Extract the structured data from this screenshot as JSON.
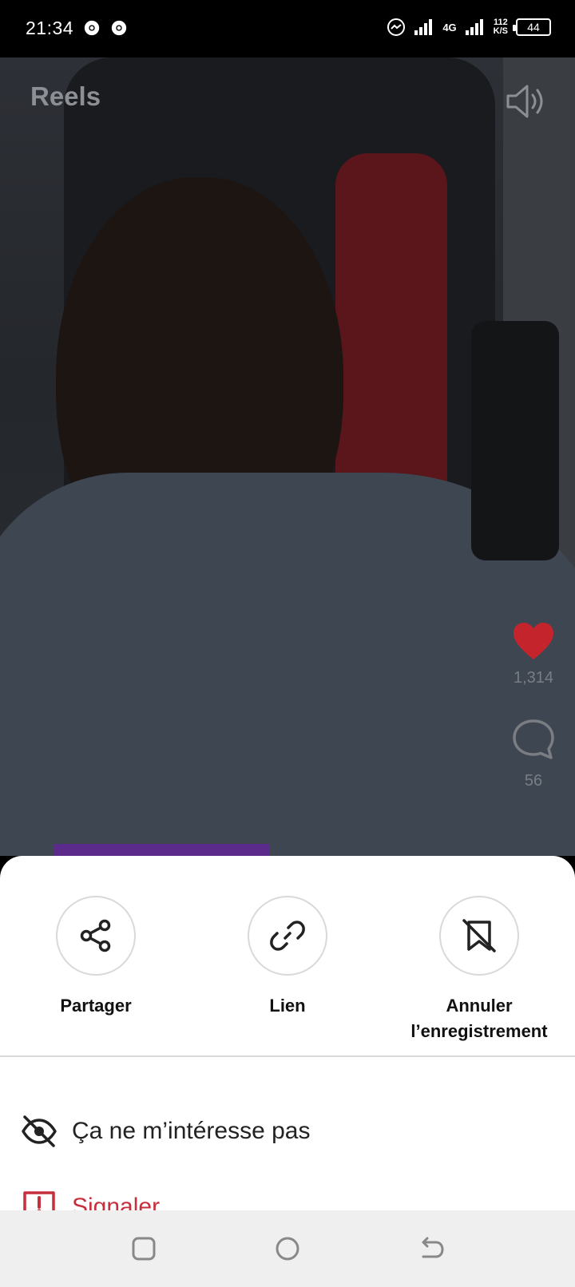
{
  "status_bar": {
    "time": "21:34",
    "network": "4G",
    "speed_value": "112",
    "speed_unit": "K/S",
    "battery": "44"
  },
  "reels": {
    "title": "Reels",
    "like_count": "1,314",
    "comment_count": "56"
  },
  "sheet": {
    "actions": [
      {
        "label": "Partager",
        "icon": "share-icon"
      },
      {
        "label": "Lien",
        "icon": "link-icon"
      },
      {
        "label": "Annuler l’enregistrement",
        "icon": "unsave-icon"
      }
    ],
    "menu": [
      {
        "label": "Ça ne m’intéresse pas",
        "icon": "hidden-eye-icon"
      },
      {
        "label": "Signaler",
        "icon": "report-icon"
      }
    ]
  },
  "colors": {
    "report_red": "#c62f3c",
    "like_red": "#c4252d"
  }
}
